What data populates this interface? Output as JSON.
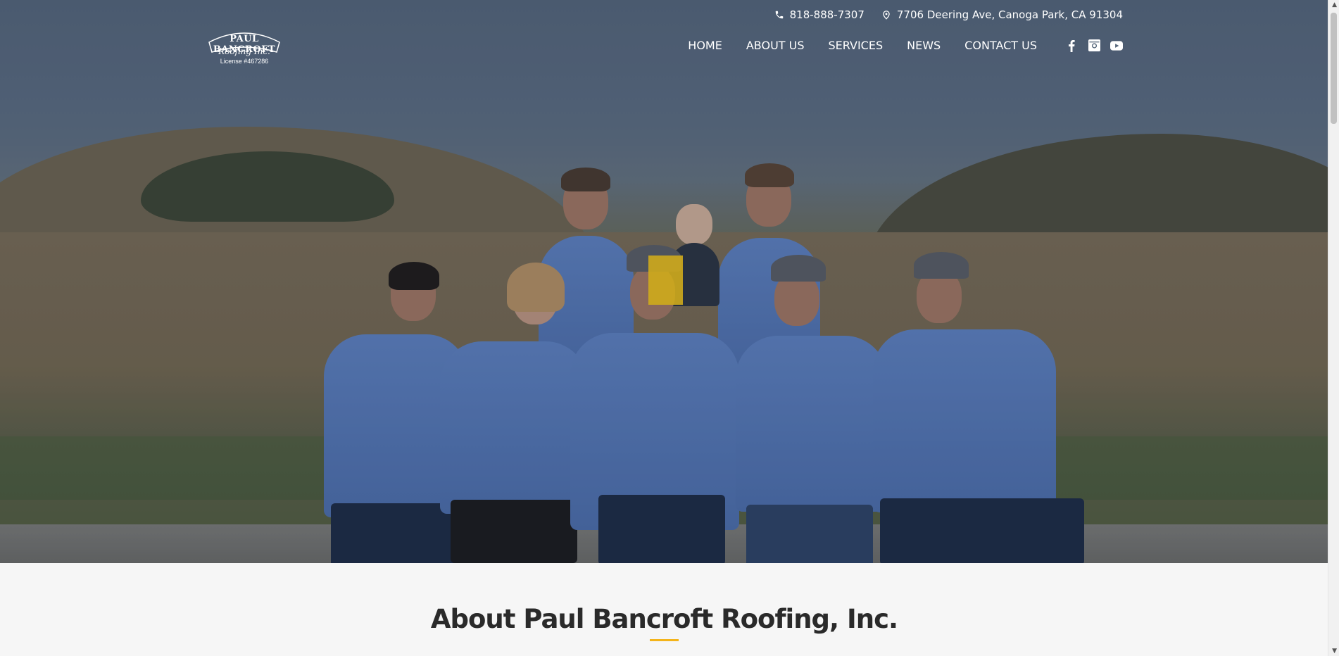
{
  "header": {
    "logo": {
      "name": "PAUL BANCROFT",
      "sub": "Roofing Inc.",
      "license": "License #467286"
    },
    "phone": "818-888-7307",
    "address": "7706 Deering Ave, Canoga Park, CA 91304",
    "nav": [
      {
        "label": "HOME"
      },
      {
        "label": "ABOUT US"
      },
      {
        "label": "SERVICES"
      },
      {
        "label": "NEWS"
      },
      {
        "label": "CONTACT US"
      }
    ],
    "social": [
      "facebook-icon",
      "instagram-icon",
      "youtube-icon"
    ]
  },
  "about": {
    "title": "About Paul Bancroft Roofing, Inc."
  },
  "colors": {
    "accent": "#f4b41a",
    "shirt": "#5a7fc0",
    "heading": "#2a2a2a",
    "nav_text": "#ffffff"
  }
}
